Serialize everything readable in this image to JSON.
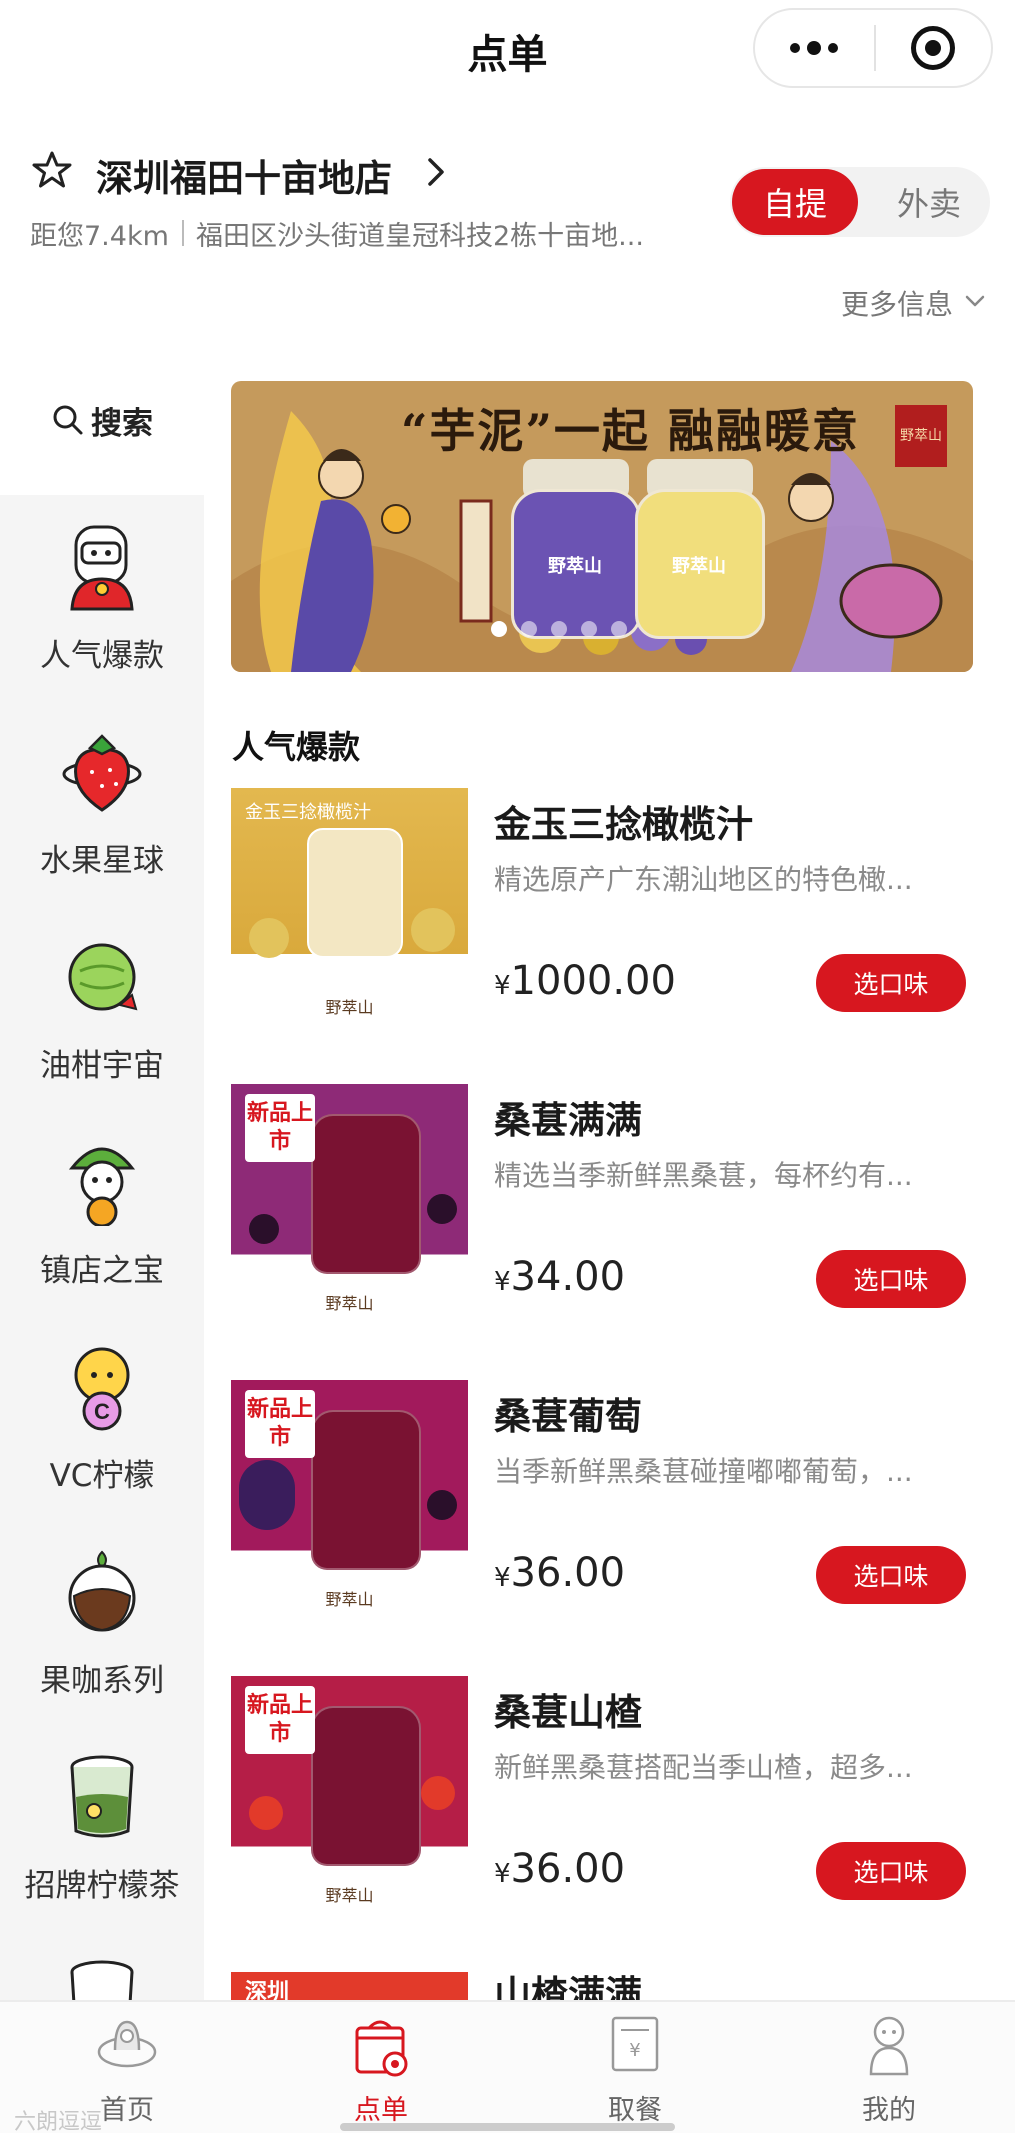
{
  "header": {
    "title": "点单"
  },
  "store": {
    "name": "深圳福田十亩地店",
    "distance": "距您7.4km",
    "address": "福田区沙头街道皇冠科技2栋十亩地...",
    "mode_active": "自提",
    "mode_inactive": "外卖",
    "more_info": "更多信息"
  },
  "sidebar": {
    "search_label": "搜索",
    "categories": [
      {
        "label": "人气爆款",
        "icon": "popular-icon"
      },
      {
        "label": "水果星球",
        "icon": "strawberry-planet-icon"
      },
      {
        "label": "油柑宇宙",
        "icon": "yougan-icon"
      },
      {
        "label": "镇店之宝",
        "icon": "treasure-icon"
      },
      {
        "label": "VC柠檬",
        "icon": "vc-lemon-icon"
      },
      {
        "label": "果咖系列",
        "icon": "fruit-coffee-icon"
      },
      {
        "label": "招牌柠檬茶",
        "icon": "lemon-tea-icon"
      }
    ]
  },
  "banner": {
    "slogan": "“芋泥”一起 融融暖意",
    "jar_left_label": "野萃山",
    "jar_right_label": "野萃山",
    "seal": "野萃山",
    "slide_count": 5,
    "active_slide": 1
  },
  "section": {
    "title": "人气爆款"
  },
  "products": [
    {
      "name": "金玉三捻橄榄汁",
      "desc": "精选原产广东潮汕地区的特色橄...",
      "currency": "¥",
      "price": "1000.00",
      "button": "选口味",
      "badge": "",
      "image_text": "金玉三捻橄榄汁",
      "brand": "野萃山",
      "color": "#e1b553"
    },
    {
      "name": "桑葚满满",
      "desc": "精选当季新鲜黑桑葚，每杯约有...",
      "currency": "¥",
      "price": "34.00",
      "button": "选口味",
      "badge": "新品上市",
      "brand": "野萃山",
      "color": "#8e2a77"
    },
    {
      "name": "桑葚葡萄",
      "desc": "当季新鲜黑桑葚碰撞嘟嘟葡萄，...",
      "currency": "¥",
      "price": "36.00",
      "button": "选口味",
      "badge": "新品上市",
      "brand": "野萃山",
      "color": "#a21a5c"
    },
    {
      "name": "桑葚山楂",
      "desc": "新鲜黑桑葚搭配当季山楂，超多...",
      "currency": "¥",
      "price": "36.00",
      "button": "选口味",
      "badge": "新品上市",
      "brand": "野萃山",
      "color": "#b51e47"
    }
  ],
  "peek": {
    "name": "山楂满满",
    "badge": "深圳"
  },
  "tabbar": [
    {
      "label": "首页",
      "icon": "home-icon",
      "active": false
    },
    {
      "label": "点单",
      "icon": "order-icon",
      "active": true
    },
    {
      "label": "取餐",
      "icon": "pickup-icon",
      "active": false
    },
    {
      "label": "我的",
      "icon": "profile-icon",
      "active": false
    }
  ],
  "watermark": "六朗逗逗",
  "colors": {
    "accent": "#d7171f",
    "sidebar_bg": "#f5f5f5",
    "banner_bg": "#c59a5c"
  }
}
